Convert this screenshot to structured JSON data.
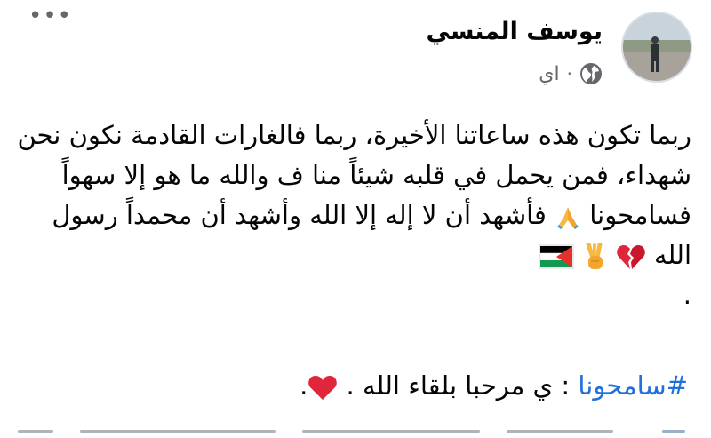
{
  "header": {
    "author_name": "يوسف المنسي",
    "time_label": "اي",
    "separator": "·",
    "more_label": "•••"
  },
  "post": {
    "lines": [
      "ربما تكون هذه ساعاتنا الأخيرة، ربما فالغارات القادمة نكون نحن",
      "شهداء، فمن يحمل في قلبه شيئاً منا ف والله ما هو إلا سهواً",
      "فسامحونا",
      "فأشهد أن لا إله إلا الله وأشهد أن محمداً رسول",
      "الله",
      "."
    ],
    "hashtag": "#سامحونا",
    "hashtag_rest": " : ي مرحبا بلقاء الله . ",
    "end_dot": "."
  },
  "icons": {
    "globe": "globe-icon",
    "folded_hands": "folded-hands-emoji",
    "broken_heart": "broken-heart-emoji",
    "victory_hand": "victory-hand-emoji",
    "palestine_flag": "palestine-flag-emoji",
    "red_heart": "red-heart-emoji"
  },
  "colors": {
    "hashtag": "#216fdb",
    "meta": "#65676b",
    "heart": "#e0263a",
    "flag_red": "#e4312b",
    "flag_green": "#149954"
  }
}
